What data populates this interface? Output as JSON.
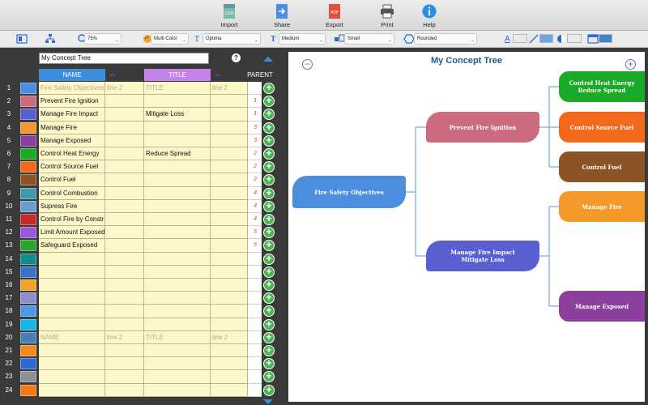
{
  "toolbar": {
    "buttons": [
      {
        "label": "Import",
        "icon": "csv-import-icon"
      },
      {
        "label": "Share",
        "icon": "share-icon"
      },
      {
        "label": "Export",
        "icon": "pdf-export-icon"
      },
      {
        "label": "Print",
        "icon": "print-icon"
      },
      {
        "label": "Help",
        "icon": "info-icon"
      }
    ]
  },
  "format_bar": {
    "zoom": "75%",
    "color_scheme": "Multi Color",
    "font": "Optima",
    "weight": "Medium",
    "size": "Small",
    "shape": "Rounded",
    "font_color_swatch": "#ffffff",
    "line_color_swatch": "#6aa8e0",
    "fill_color_swatch": "#ffffff",
    "layout_swatch": "#3f86c9"
  },
  "editor": {
    "title_value": "My Concept Tree",
    "help": "?",
    "columns": {
      "name": "NAME",
      "title": "TITLE",
      "parent": "PARENT"
    },
    "rows": [
      {
        "n": "1",
        "color": "#4a8ee0",
        "name": "Fire Safety Objectives",
        "line2": "line 2",
        "title": "TITLE",
        "tline2": "line 2",
        "parent": "",
        "ph": true
      },
      {
        "n": "2",
        "color": "#cc6b7e",
        "name": "Prevent Fire Ignition",
        "line2": "",
        "title": "",
        "tline2": "",
        "parent": "1",
        "ph": false
      },
      {
        "n": "3",
        "color": "#5a5fcf",
        "name": "Manage Fire Impact",
        "line2": "",
        "title": "Mitigate Loss",
        "tline2": "",
        "parent": "1",
        "ph": false
      },
      {
        "n": "4",
        "color": "#f59a2a",
        "name": "Manage Fire",
        "line2": "",
        "title": "",
        "tline2": "",
        "parent": "3",
        "ph": false
      },
      {
        "n": "5",
        "color": "#8c3f9c",
        "name": "Manage Exposed",
        "line2": "",
        "title": "",
        "tline2": "",
        "parent": "3",
        "ph": false
      },
      {
        "n": "6",
        "color": "#1aaa28",
        "name": "Control Heat Energy",
        "line2": "",
        "title": "Reduce Spread",
        "tline2": "",
        "parent": "2",
        "ph": false
      },
      {
        "n": "7",
        "color": "#f2691e",
        "name": "Control Source Fuel",
        "line2": "",
        "title": "",
        "tline2": "",
        "parent": "2",
        "ph": false
      },
      {
        "n": "8",
        "color": "#8c5426",
        "name": "Control Fuel",
        "line2": "",
        "title": "",
        "tline2": "",
        "parent": "2",
        "ph": false
      },
      {
        "n": "9",
        "color": "#3f9aaa",
        "name": "Control Combustion",
        "line2": "",
        "title": "",
        "tline2": "",
        "parent": "4",
        "ph": false
      },
      {
        "n": "10",
        "color": "#6a9ed2",
        "name": "Supress Fire",
        "line2": "",
        "title": "",
        "tline2": "",
        "parent": "4",
        "ph": false
      },
      {
        "n": "11",
        "color": "#c42a2a",
        "name": "Control Fire by Constr",
        "line2": "",
        "title": "",
        "tline2": "",
        "parent": "4",
        "ph": false
      },
      {
        "n": "12",
        "color": "#9b56d9",
        "name": "Limit Amount Exposed",
        "line2": "",
        "title": "",
        "tline2": "",
        "parent": "5",
        "ph": false
      },
      {
        "n": "13",
        "color": "#2aa32e",
        "name": "Safeguard Exposed",
        "line2": "",
        "title": "",
        "tline2": "",
        "parent": "5",
        "ph": false
      },
      {
        "n": "14",
        "color": "#138c8c",
        "name": "",
        "line2": "",
        "title": "",
        "tline2": "",
        "parent": "",
        "ph": false
      },
      {
        "n": "15",
        "color": "#3b72c9",
        "name": "",
        "line2": "",
        "title": "",
        "tline2": "",
        "parent": "",
        "ph": false
      },
      {
        "n": "16",
        "color": "#f2a42a",
        "name": "",
        "line2": "",
        "title": "",
        "tline2": "",
        "parent": "",
        "ph": false
      },
      {
        "n": "17",
        "color": "#8c8fcf",
        "name": "",
        "line2": "",
        "title": "",
        "tline2": "",
        "parent": "",
        "ph": false
      },
      {
        "n": "18",
        "color": "#4f97e8",
        "name": "",
        "line2": "",
        "title": "",
        "tline2": "",
        "parent": "",
        "ph": false
      },
      {
        "n": "19",
        "color": "#19b5e8",
        "name": "",
        "line2": "",
        "title": "",
        "tline2": "",
        "parent": "",
        "ph": false
      },
      {
        "n": "20",
        "color": "#4a7fb5",
        "name": "NAME",
        "line2": "line 2",
        "title": "TITLE",
        "tline2": "line 2",
        "parent": "",
        "ph": true
      },
      {
        "n": "21",
        "color": "#f28a1e",
        "name": "",
        "line2": "",
        "title": "",
        "tline2": "",
        "parent": "",
        "ph": false
      },
      {
        "n": "22",
        "color": "#2a6ad1",
        "name": "",
        "line2": "",
        "title": "",
        "tline2": "",
        "parent": "",
        "ph": false
      },
      {
        "n": "23",
        "color": "#8d9096",
        "name": "",
        "line2": "",
        "title": "",
        "tline2": "",
        "parent": "",
        "ph": false
      },
      {
        "n": "24",
        "color": "#f07a1a",
        "name": "",
        "line2": "",
        "title": "",
        "tline2": "",
        "parent": "",
        "ph": false
      }
    ]
  },
  "map": {
    "title": "My Concept Tree",
    "nodes": [
      {
        "text": "Fire Safety Objectives",
        "color": "#4a8ee0"
      },
      {
        "text": "Prevent Fire Ignition",
        "color": "#cc6b7e"
      },
      {
        "text": "Manage Fire Impact\nMitigate Loss",
        "color": "#5a5fcf"
      },
      {
        "text": "Control Heat Energy\nReduce Spread",
        "color": "#1aaa28"
      },
      {
        "text": "Control Source Fuel",
        "color": "#f2691e"
      },
      {
        "text": "Control Fuel",
        "color": "#8c5426"
      },
      {
        "text": "Manage Fire",
        "color": "#f59a2a"
      },
      {
        "text": "Manage Exposed",
        "color": "#8c3f9c"
      }
    ],
    "line_color": "#5a9ad8"
  }
}
